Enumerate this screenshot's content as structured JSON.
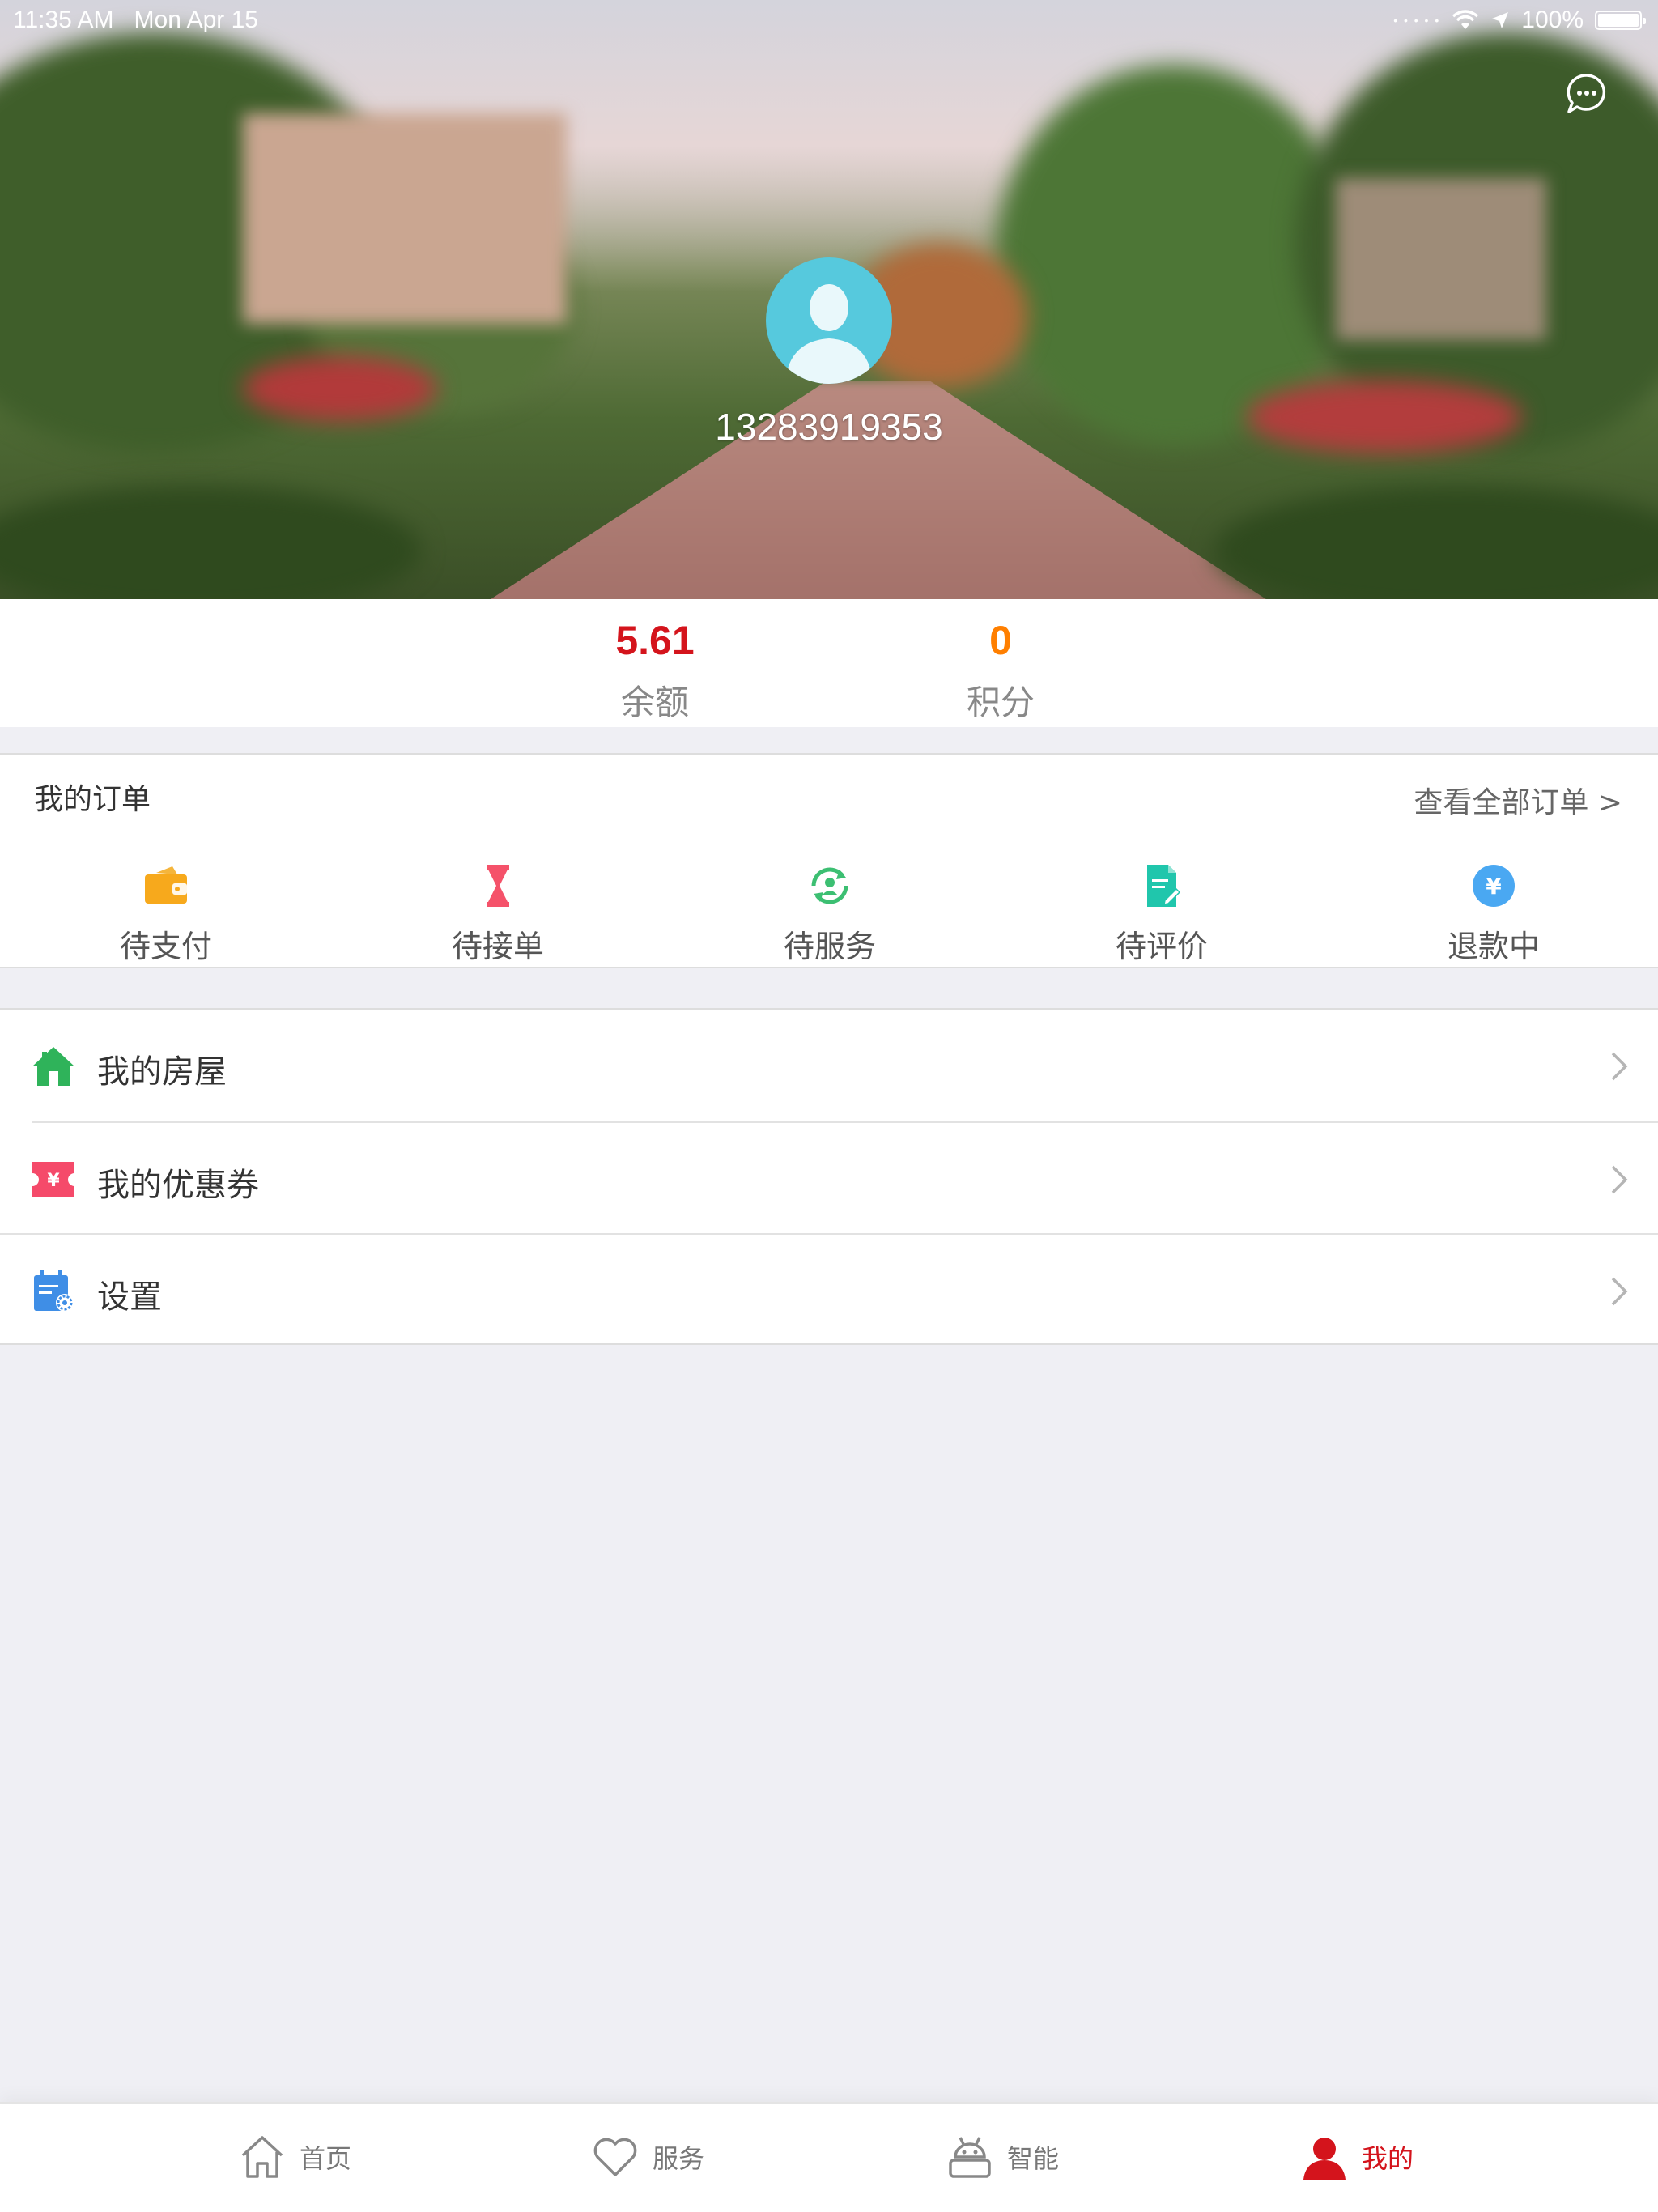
{
  "status_bar": {
    "time": "11:35 AM",
    "date": "Mon Apr 15",
    "battery": "100%"
  },
  "profile": {
    "phone": "13283919353"
  },
  "stats": {
    "balance": {
      "value": "5.61",
      "label": "余额",
      "color": "#d4141c"
    },
    "points": {
      "value": "0",
      "label": "积分",
      "color": "#ff7f00"
    }
  },
  "orders": {
    "title": "我的订单",
    "view_all": "查看全部订单 >",
    "items": [
      {
        "label": "待支付",
        "icon": "wallet-icon"
      },
      {
        "label": "待接单",
        "icon": "hourglass-icon"
      },
      {
        "label": "待服务",
        "icon": "service-refresh-icon"
      },
      {
        "label": "待评价",
        "icon": "review-document-icon"
      },
      {
        "label": "退款中",
        "icon": "yen-coin-icon"
      }
    ]
  },
  "menu": {
    "items": [
      {
        "label": "我的房屋",
        "icon": "house-icon"
      },
      {
        "label": "我的优惠券",
        "icon": "coupon-icon"
      },
      {
        "label": "设置",
        "icon": "settings-icon"
      }
    ]
  },
  "tabbar": {
    "tabs": [
      {
        "label": "首页",
        "icon": "home-icon"
      },
      {
        "label": "服务",
        "icon": "heart-icon"
      },
      {
        "label": "智能",
        "icon": "robot-icon"
      },
      {
        "label": "我的",
        "icon": "user-icon"
      }
    ],
    "active": "我的",
    "active_color": "#d4141c"
  }
}
